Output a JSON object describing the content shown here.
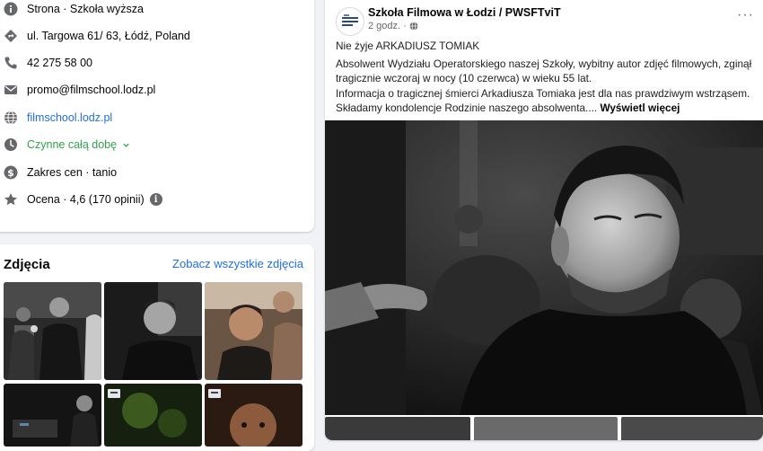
{
  "intro": {
    "category": "Strona · Szkoła wyższa",
    "address": "ul. Targowa 61/ 63, Łódź, Poland",
    "phone": "42 275 58 00",
    "email": "promo@filmschool.lodz.pl",
    "website": "filmschool.lodz.pl",
    "hours": "Czynne całą dobę",
    "price": "Zakres cen · tanio",
    "rating": "Ocena · 4,6 (170 opinii)",
    "icons": [
      "info-icon",
      "location-icon",
      "phone-icon",
      "email-icon",
      "globe-icon",
      "clock-icon",
      "dollar-icon",
      "star-icon"
    ]
  },
  "photos": {
    "title": "Zdjęcia",
    "see_all": "Zobacz wszystkie zdjęcia"
  },
  "post": {
    "author": "Szkoła Filmowa w Łodzi / PWSFTviT",
    "time": "2 godz.",
    "more": "···",
    "headline": "Nie żyje ARKADIUSZ TOMIAK",
    "paragraph1": "Absolwent Wydziału Operatorskiego naszej Szkoły, wybitny autor zdjęć filmowych, zginął tragicznie wczoraj w nocy (10 czerwca) w wieku 55 lat.",
    "paragraph2": "Informacja o tragicznej śmierci Arkadiusza Tomiaka jest dla nas prawdziwym wstrząsem. Składamy kondolencje Rodzinie naszego absolwenta....",
    "see_more": "Wyświetl więcej"
  },
  "colors": {
    "link": "#216fdb",
    "open_green": "#31a24c",
    "icon_gray": "#65676b",
    "background": "#f0f2f5"
  }
}
